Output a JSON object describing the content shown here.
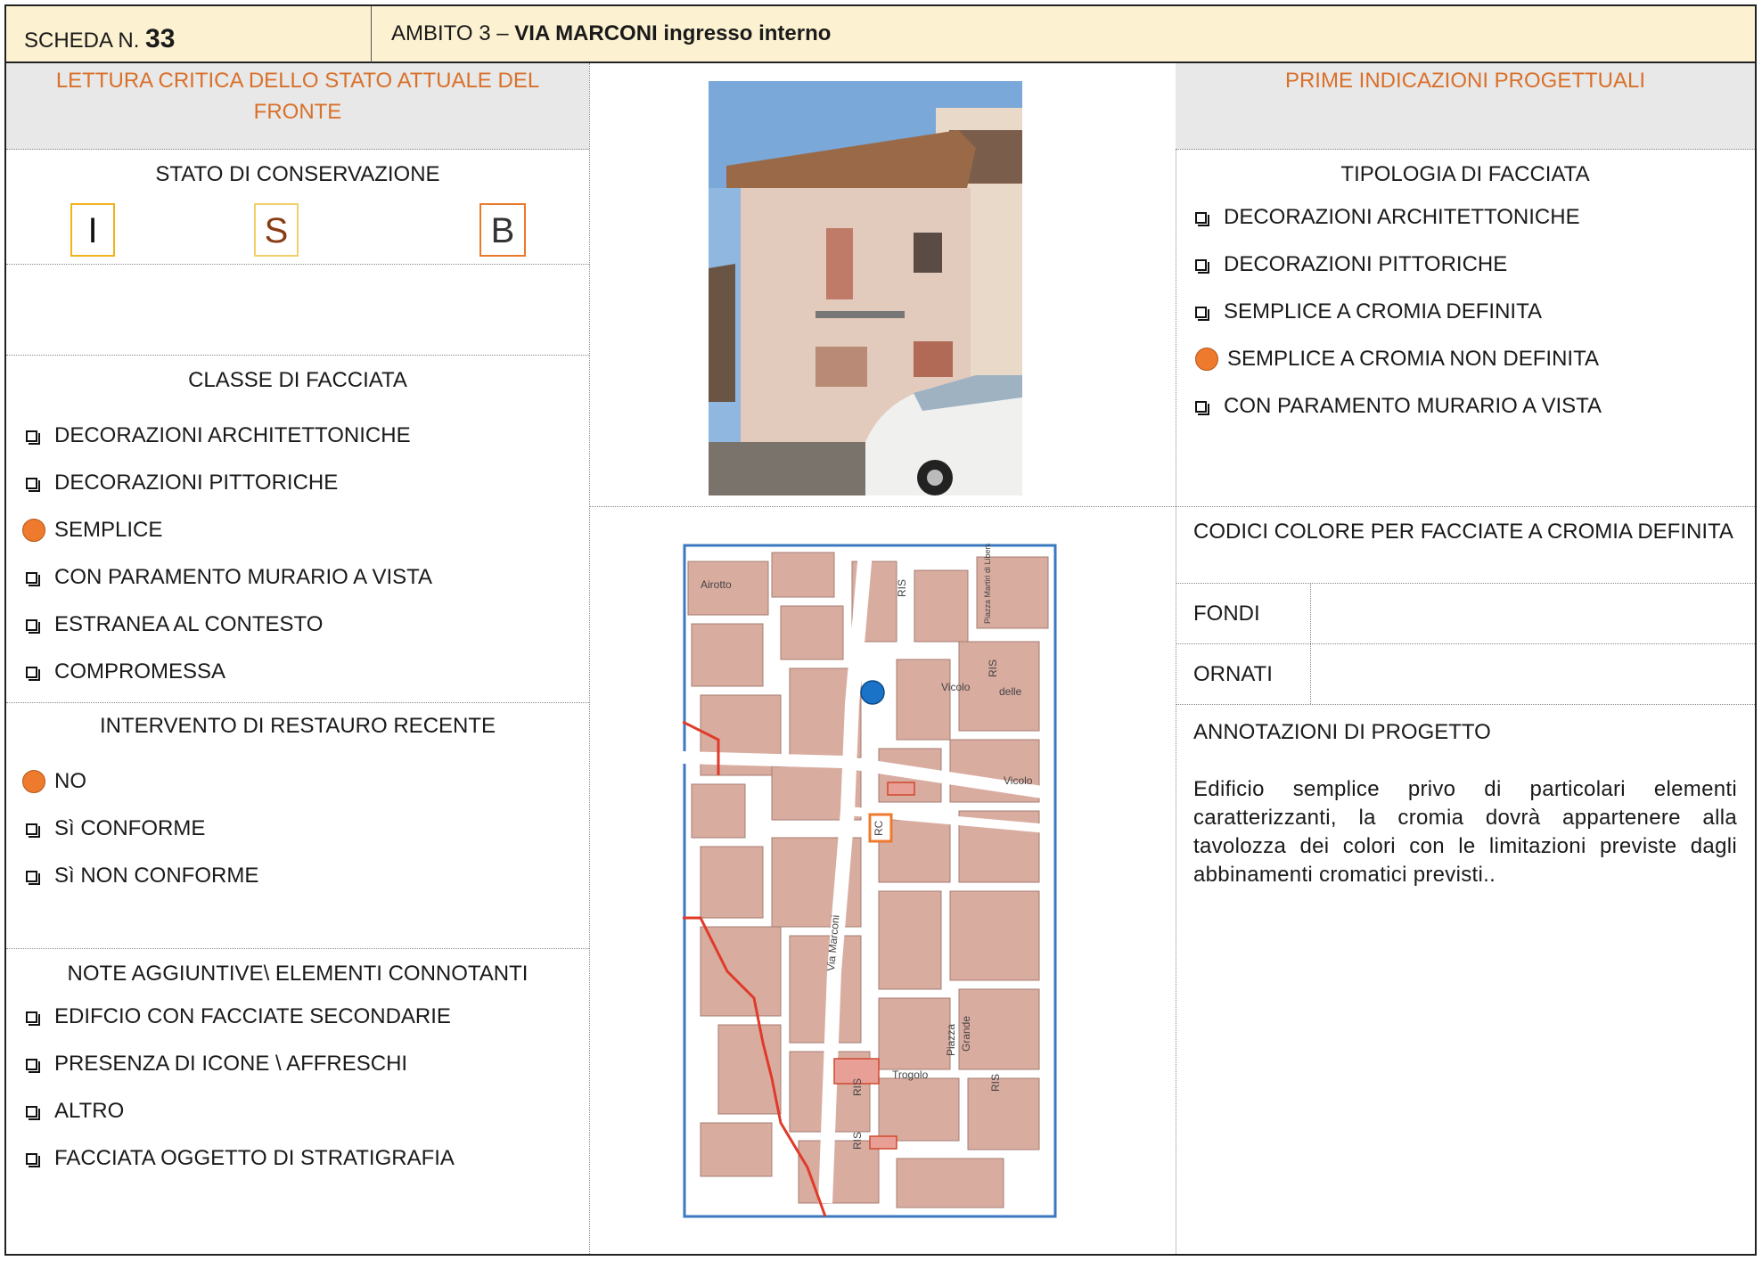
{
  "header": {
    "scheda_label": "SCHEDA N.",
    "scheda_number": "33",
    "ambito_prefix": "AMBITO 3 –",
    "ambito_name": "VIA MARCONI ingresso interno"
  },
  "left": {
    "title": "LETTURA CRITICA DELLO STATO ATTUALE DEL FRONTE",
    "stato": {
      "title": "STATO DI CONSERVAZIONE",
      "boxes": [
        "I",
        "S",
        "B"
      ]
    },
    "classe": {
      "title": "CLASSE DI FACCIATA",
      "items": [
        {
          "label": "DECORAZIONI ARCHITETTONICHE",
          "selected": false
        },
        {
          "label": "DECORAZIONI PITTORICHE",
          "selected": false
        },
        {
          "label": "SEMPLICE",
          "selected": true
        },
        {
          "label": "CON PARAMENTO MURARIO A VISTA",
          "selected": false
        },
        {
          "label": "ESTRANEA AL CONTESTO",
          "selected": false
        },
        {
          "label": "COMPROMESSA",
          "selected": false
        }
      ]
    },
    "intervento": {
      "title": "INTERVENTO DI RESTAURO RECENTE",
      "items": [
        {
          "label": "NO",
          "selected": true
        },
        {
          "label": "Sì CONFORME",
          "selected": false
        },
        {
          "label": "Sì NON CONFORME",
          "selected": false
        }
      ]
    },
    "note": {
      "title": "NOTE AGGIUNTIVE\\ ELEMENTI CONNOTANTI",
      "items": [
        {
          "label": "EDIFCIO CON FACCIATE SECONDARIE",
          "selected": false
        },
        {
          "label": "PRESENZA DI ICONE \\ AFFRESCHI",
          "selected": false
        },
        {
          "label": "ALTRO",
          "selected": false
        },
        {
          "label": "FACCIATA OGGETTO DI STRATIGRAFIA",
          "selected": false
        }
      ]
    }
  },
  "center": {
    "map_labels": {
      "ris": "RIS",
      "rc": "RC",
      "via_marconi": "Via Marconi",
      "vicolo": "Vicolo",
      "piazza": "Piazza",
      "grande": "Grande",
      "airotto": "Airotto",
      "delle": "delle",
      "trogolo": "Trogolo",
      "martiri": "Piazza Martiri di Libertà"
    }
  },
  "right": {
    "title": "PRIME INDICAZIONI PROGETTUALI",
    "tipologia": {
      "title": "TIPOLOGIA DI FACCIATA",
      "items": [
        {
          "label": "DECORAZIONI ARCHITETTONICHE",
          "selected": false
        },
        {
          "label": "DECORAZIONI PITTORICHE",
          "selected": false
        },
        {
          "label": "SEMPLICE A CROMIA DEFINITA",
          "selected": false
        },
        {
          "label": "SEMPLICE A CROMIA NON DEFINITA",
          "selected": true
        },
        {
          "label": "CON PARAMENTO MURARIO A VISTA",
          "selected": false
        }
      ]
    },
    "codici": {
      "title": "CODICI COLORE PER FACCIATE A CROMIA DEFINITA",
      "fondi": "FONDI",
      "ornati": "ORNATI"
    },
    "annotazioni": {
      "title": "ANNOTAZIONI DI PROGETTO",
      "text": "Edificio semplice privo di particolari elementi caratterizzanti, la cromia dovrà appartenere alla tavolozza dei colori con le limitazioni previste dagli abbinamenti cromatici previsti.."
    }
  },
  "colors": {
    "accent_orange": "#d9702a",
    "dot_orange": "#ee7a2e",
    "header_bg": "#fcf1d0",
    "map_building": "#d9aca0",
    "map_border": "#3a78c0"
  }
}
